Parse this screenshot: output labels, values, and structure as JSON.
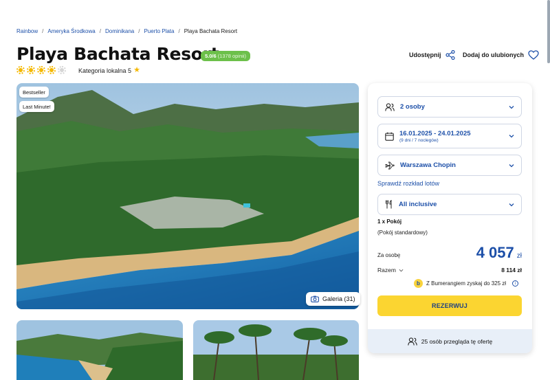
{
  "breadcrumb": [
    "Rainbow",
    "Ameryka Środkowa",
    "Dominikana",
    "Puerto Plata",
    "Playa Bachata Resort"
  ],
  "hotel": {
    "name": "Playa Bachata Resort",
    "rating_score": "5.0/6",
    "rating_opinions": "(1378 opinii)",
    "stars": 4,
    "stars_max": 5,
    "local_category": "Kategoria lokalna 5"
  },
  "actions": {
    "share": "Udostępnij",
    "favorite": "Dodaj do ulubionych"
  },
  "gallery": {
    "badges": [
      "Bestseller",
      "Last Minute!"
    ],
    "button": "Galeria (31)"
  },
  "booking": {
    "persons": "2 osoby",
    "dates": "16.01.2025 - 24.01.2025",
    "duration": "(9 dni / 7 noclegów)",
    "airport": "Warszawa Chopin",
    "flights_link": "Sprawdź rozkład lotów",
    "board": "All inclusive",
    "room_count": "1 x Pokój",
    "room_type": "(Pokój standardowy)",
    "per_person_label": "Za osobę",
    "price": "4 057",
    "currency": "zł",
    "total_label": "Razem",
    "total_value": "8 114 zł",
    "boomerang_text": "Z Bumerangiem zyskaj do 325 zł",
    "reserve": "REZERWUJ",
    "viewers": "25 osób przegląda tę ofertę"
  },
  "colors": {
    "brand_blue": "#1c4fa8",
    "rating_green": "#6cc04a",
    "cta_yellow": "#fbd531"
  }
}
